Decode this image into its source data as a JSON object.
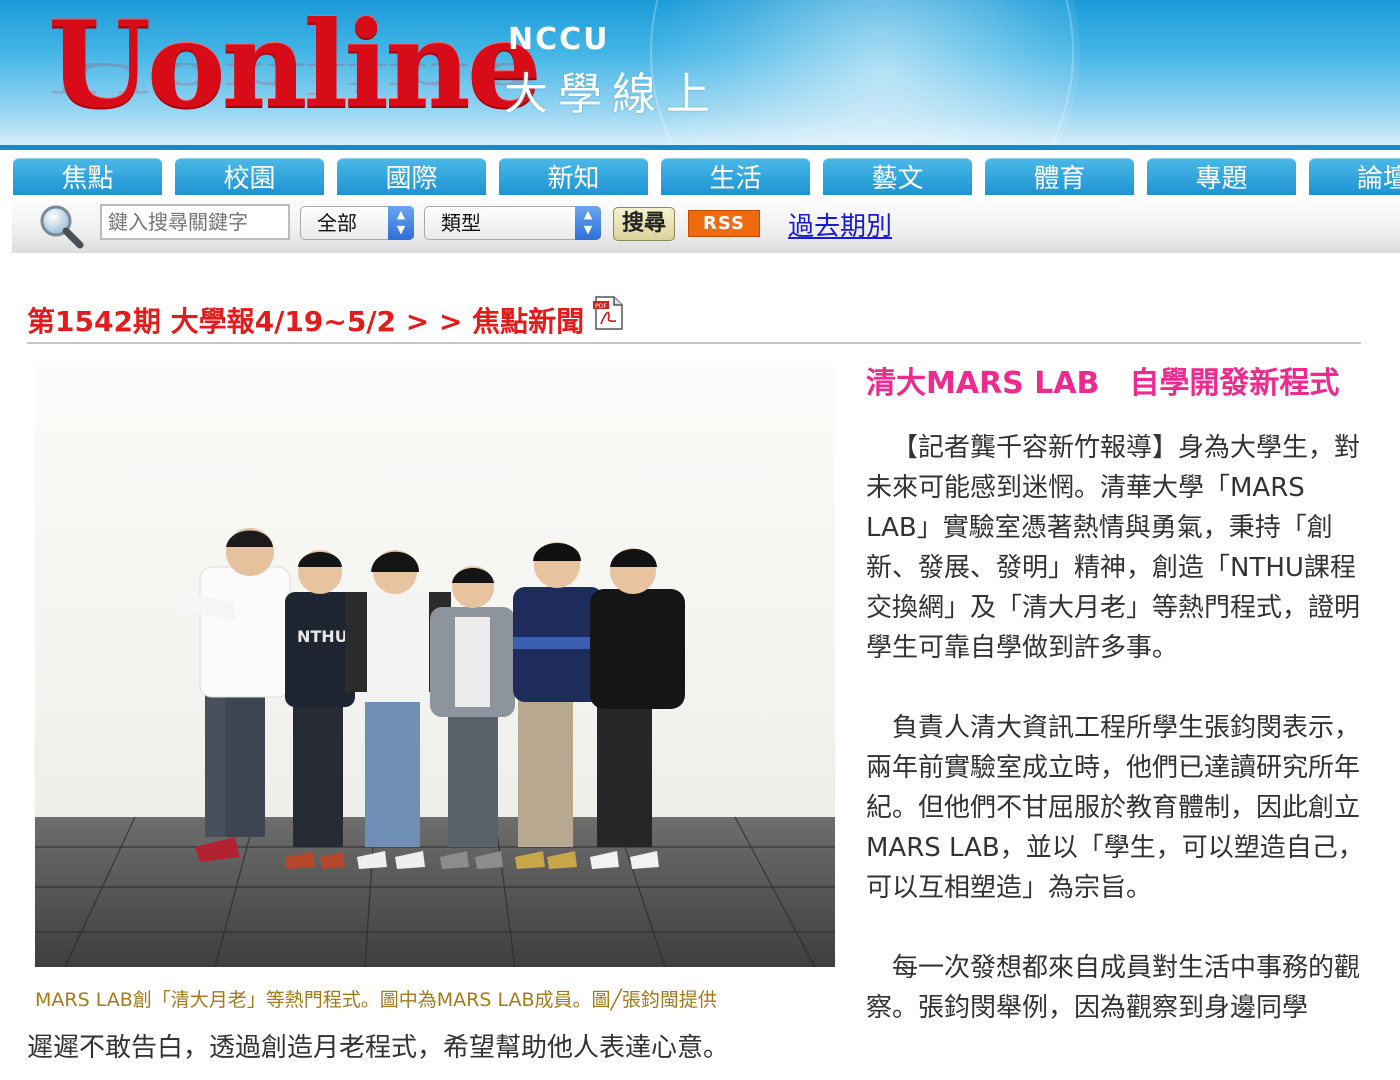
{
  "header": {
    "logo_text": "Uonline",
    "school": "NCCU",
    "subtitle": "大學線上"
  },
  "nav": {
    "tabs": [
      {
        "label": "焦點"
      },
      {
        "label": "校園"
      },
      {
        "label": "國際"
      },
      {
        "label": "新知"
      },
      {
        "label": "生活"
      },
      {
        "label": "藝文"
      },
      {
        "label": "體育"
      },
      {
        "label": "專題"
      },
      {
        "label": "論壇"
      }
    ]
  },
  "toolbar": {
    "search_placeholder": "鍵入搜尋關鍵字",
    "scope_select": "全部",
    "type_select": "類型",
    "search_button": "搜尋",
    "rss_button": "RSS",
    "past_issues_link": "過去期別"
  },
  "breadcrumb": {
    "text": "第1542期 大學報4/19~5/2 > > 焦點新聞"
  },
  "article": {
    "headline": "清大MARS LAB　自學開發新程式",
    "photo_caption": "MARS LAB創「清大月老」等熱門程式。圖中為MARS LAB成員。圖╱張鈞閩提供",
    "paragraphs": [
      "【記者龔千容新竹報導】身為大學生，對未來可能感到迷惘。清華大學「MARS LAB」實驗室憑著熱情與勇氣，秉持「創新、發展、發明」精神，創造「NTHU課程交換網」及「清大月老」等熱門程式，證明學生可靠自學做到許多事。",
      "負責人清大資訊工程所學生張鈞閔表示，兩年前實驗室成立時，他們已達讀研究所年紀。但他們不甘屈服於教育體制，因此創立MARS LAB，並以「學生，可以塑造自己，可以互相塑造」為宗旨。",
      "每一次發想都來自成員對生活中事務的觀察。張鈞閔舉例，因為觀察到身邊同學"
    ],
    "paragraph_continuation": "遲遲不敢告白，透過創造月老程式，希望幫助他人表達心意。"
  },
  "colors": {
    "logo_red": "#d80c18",
    "nav_blue": "#1c93d2",
    "breadcrumb_red": "#e31b1b",
    "headline_pink": "#ee2a8f",
    "caption_gold": "#a57a1b",
    "link_blue": "#1a1ad8",
    "rss_orange": "#f06a0f"
  }
}
